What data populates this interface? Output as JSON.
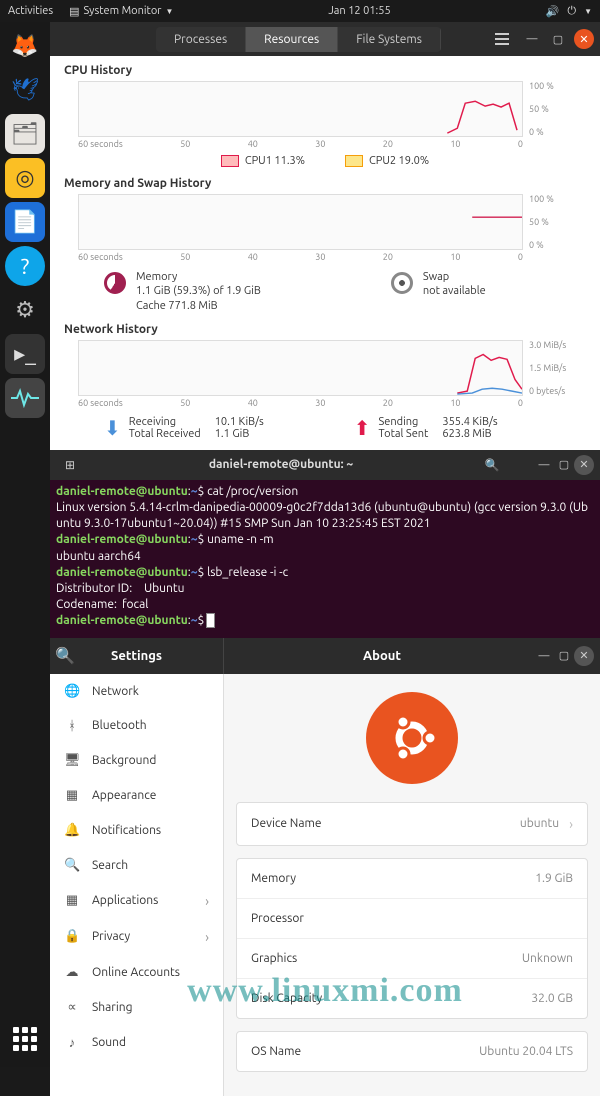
{
  "topbar": {
    "activities": "Activities",
    "app_name": "System Monitor",
    "datetime": "Jan 12  01:55"
  },
  "sysmon": {
    "tabs": [
      "Processes",
      "Resources",
      "File Systems"
    ],
    "cpu": {
      "title": "CPU History",
      "y": [
        "100 %",
        "50 %",
        "0 %"
      ],
      "x": [
        "60 seconds",
        "50",
        "40",
        "30",
        "20",
        "10",
        "0"
      ],
      "legend": [
        {
          "label": "CPU1  11.3%",
          "color": "#e01b4c"
        },
        {
          "label": "CPU2  19.0%",
          "color": "#f59e0b"
        }
      ]
    },
    "mem": {
      "title": "Memory and Swap History",
      "y": [
        "100 %",
        "50 %",
        "0 %"
      ],
      "x": [
        "60 seconds",
        "50",
        "40",
        "30",
        "20",
        "10",
        "0"
      ],
      "memory": {
        "label": "Memory",
        "line1": "1.1 GiB (59.3%) of 1.9 GiB",
        "line2": "Cache 771.8 MiB"
      },
      "swap": {
        "label": "Swap",
        "line1": "not available"
      }
    },
    "net": {
      "title": "Network History",
      "y": [
        "3.0 MiB/s",
        "1.5 MiB/s",
        "0 bytes/s"
      ],
      "x": [
        "60 seconds",
        "50",
        "40",
        "30",
        "20",
        "10",
        "0"
      ],
      "recv": {
        "label1": "Receiving",
        "val1": "10.1 KiB/s",
        "label2": "Total Received",
        "val2": "1.1 GiB"
      },
      "send": {
        "label1": "Sending",
        "val1": "355.4 KiB/s",
        "label2": "Total Sent",
        "val2": "623.8 MiB"
      }
    }
  },
  "terminal": {
    "title": "daniel-remote@ubuntu: ~",
    "prompt_user": "daniel-remote@ubuntu",
    "prompt_path": "~",
    "lines": {
      "cmd1": "cat /proc/version",
      "out1": "Linux version 5.4.14-crlm-danipedia-00009-g0c2f7dda13d6 (ubuntu@ubuntu) (gcc version 9.3.0 (Ubuntu 9.3.0-17ubuntu1~20.04)) #15 SMP Sun Jan 10 23:25:45 EST 2021",
      "cmd2": "uname -n -m",
      "out2": "ubuntu aarch64",
      "cmd3": "lsb_release -i -c",
      "out3a": "Distributor ID:\tUbuntu",
      "out3b": "Codename:\tfocal"
    }
  },
  "settings": {
    "sidebar_title": "Settings",
    "content_title": "About",
    "items": [
      {
        "icon": "🌐",
        "label": "Network"
      },
      {
        "icon": "ᚼ",
        "label": "Bluetooth"
      },
      {
        "icon": "🖥",
        "label": "Background"
      },
      {
        "icon": "▦",
        "label": "Appearance"
      },
      {
        "icon": "🔔",
        "label": "Notifications"
      },
      {
        "icon": "🔍",
        "label": "Search"
      },
      {
        "icon": "▦",
        "label": "Applications",
        "chev": true
      },
      {
        "icon": "🔒",
        "label": "Privacy",
        "chev": true
      },
      {
        "icon": "☁",
        "label": "Online Accounts"
      },
      {
        "icon": "∝",
        "label": "Sharing"
      },
      {
        "icon": "♪",
        "label": "Sound"
      }
    ],
    "device": {
      "label": "Device Name",
      "value": "ubuntu"
    },
    "specs": [
      {
        "label": "Memory",
        "value": "1.9 GiB"
      },
      {
        "label": "Processor",
        "value": ""
      },
      {
        "label": "Graphics",
        "value": "Unknown"
      },
      {
        "label": "Disk Capacity",
        "value": "32.0 GB"
      }
    ],
    "os": {
      "label": "OS Name",
      "value": "Ubuntu 20.04 LTS"
    }
  },
  "watermark": "www.linuxmi.com",
  "chart_data": [
    {
      "type": "line",
      "title": "CPU History",
      "xlabel": "seconds",
      "ylabel": "%",
      "ylim": [
        0,
        100
      ],
      "xlim": [
        60,
        0
      ],
      "x_ticks": [
        60,
        50,
        40,
        30,
        20,
        10,
        0
      ],
      "series": [
        {
          "name": "CPU1",
          "current": 11.3,
          "values_tail": [
            5,
            10,
            45,
            60,
            55,
            50,
            48,
            55,
            50,
            12
          ]
        },
        {
          "name": "CPU2",
          "current": 19.0,
          "values_tail": [
            5,
            8,
            40,
            55,
            50,
            45,
            50,
            55,
            45,
            15
          ]
        }
      ]
    },
    {
      "type": "line",
      "title": "Memory and Swap History",
      "xlabel": "seconds",
      "ylabel": "%",
      "ylim": [
        0,
        100
      ],
      "xlim": [
        60,
        0
      ],
      "x_ticks": [
        60,
        50,
        40,
        30,
        20,
        10,
        0
      ],
      "series": [
        {
          "name": "Memory",
          "current_percent": 59.3,
          "values_tail": [
            59,
            59,
            59,
            59,
            59,
            59,
            59,
            59,
            59,
            59
          ]
        },
        {
          "name": "Swap",
          "available": false
        }
      ]
    },
    {
      "type": "line",
      "title": "Network History",
      "xlabel": "seconds",
      "ylabel": "MiB/s",
      "ylim": [
        0,
        3.0
      ],
      "xlim": [
        60,
        0
      ],
      "x_ticks": [
        60,
        50,
        40,
        30,
        20,
        10,
        0
      ],
      "series": [
        {
          "name": "Receiving",
          "current": "10.1 KiB/s",
          "total": "1.1 GiB",
          "values_tail_mibs": [
            0,
            0,
            0,
            0.05,
            0.2,
            0.3,
            0.25,
            0.2,
            0.1,
            0.01
          ]
        },
        {
          "name": "Sending",
          "current": "355.4 KiB/s",
          "total": "623.8 MiB",
          "values_tail_mibs": [
            0,
            0,
            0,
            0.8,
            2.0,
            2.2,
            1.8,
            1.9,
            1.7,
            0.3
          ]
        }
      ]
    }
  ]
}
